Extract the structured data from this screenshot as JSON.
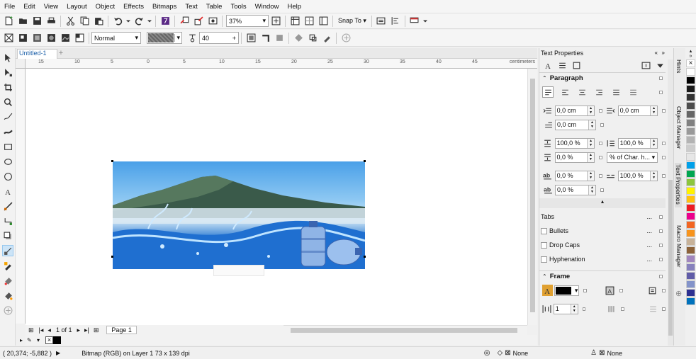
{
  "menu": [
    "File",
    "Edit",
    "View",
    "Layout",
    "Object",
    "Effects",
    "Bitmaps",
    "Text",
    "Table",
    "Tools",
    "Window",
    "Help"
  ],
  "toolbar": {
    "zoom": "37%",
    "snap_to": "Snap To"
  },
  "propbar": {
    "mode": "Normal",
    "size_value": "40"
  },
  "document": {
    "tab_title": "Untitled-1"
  },
  "ruler": {
    "units": "centimeters",
    "h_ticks": [
      "15",
      "10",
      "5",
      "0",
      "5",
      "10",
      "15",
      "20",
      "25",
      "30",
      "35",
      "40",
      "45"
    ]
  },
  "pager": {
    "page_count": "1 of 1",
    "page_tab": "Page 1"
  },
  "panel": {
    "title": "Text Properties",
    "paragraph": {
      "title": "Paragraph",
      "left_indent": "0,0 cm",
      "right_indent": "0,0 cm",
      "first_line_indent": "0,0 cm",
      "space_before": "100,0 %",
      "line_spacing": "100,0 %",
      "space_after": "0,0 %",
      "spacing_units": "% of Char. h...",
      "char_spacing": "0,0 %",
      "word_spacing": "100,0 %",
      "lang_spacing": "0,0 %"
    },
    "tabs": "Tabs",
    "bullets": "Bullets",
    "drop_caps": "Drop Caps",
    "hyphenation": "Hyphenation",
    "frame": {
      "title": "Frame",
      "columns": "1"
    }
  },
  "docker_tabs": [
    "Hints",
    "Object Manager",
    "Text Properties",
    "Macro Manager"
  ],
  "palette_colors": [
    "#ffffff",
    "#000000",
    "#1a1a1a",
    "#333333",
    "#4d4d4d",
    "#666666",
    "#808080",
    "#999999",
    "#b3b3b3",
    "#cccccc",
    "#e6e6e6",
    "#00a0e9",
    "#00a651",
    "#8dc63f",
    "#fff200",
    "#ffc20e",
    "#ed1c24",
    "#ec008c",
    "#f26522",
    "#f7941d",
    "#c7b299",
    "#8c6239",
    "#a186be",
    "#8781bd",
    "#605ca8",
    "#8393ca",
    "#2e3192",
    "#0072bc"
  ],
  "status": {
    "coords": "( 20,374; -5,882 )",
    "info": "Bitmap (RGB) on Layer 1 73 x 139 dpi",
    "fill": "None",
    "outline": "None"
  }
}
